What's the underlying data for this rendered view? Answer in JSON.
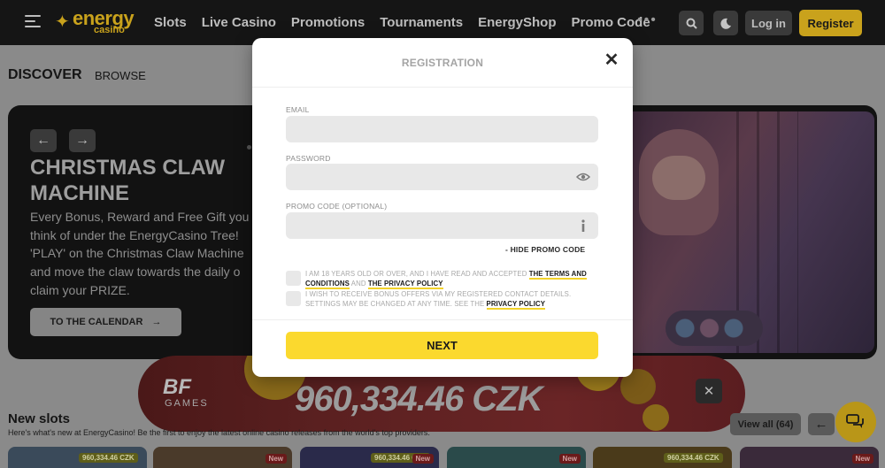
{
  "nav": {
    "logo_word": "energy",
    "logo_sub": "casino",
    "links": [
      "Slots",
      "Live Casino",
      "Promotions",
      "Tournaments",
      "EnergyShop",
      "Promo Code"
    ],
    "more": "•••",
    "login": "Log in",
    "register": "Register"
  },
  "page": {
    "discover": "DISCOVER",
    "browse": "BROWSE"
  },
  "hero": {
    "title": "CHRISTMAS CLAW MACHINE",
    "text_lines": [
      "Every Bonus, Reward and Free Gift you",
      "think of under the EnergyCasino Tree!",
      "'PLAY' on the Christmas Claw Machine",
      "and move the claw towards the daily o",
      "claim your PRIZE."
    ],
    "cta": "TO THE CALENDAR",
    "cta_arrow": "→",
    "prev": "←",
    "next": "→"
  },
  "jackpot": {
    "logo": "BF",
    "sub": "GAMES",
    "amount": "960,334.46 CZK",
    "close": "✕"
  },
  "new_slots": {
    "title": "New slots",
    "subtitle": "Here's what's new at EnergyCasino! Be the first to enjoy the latest online casino releases from the world's top providers.",
    "view_all": "View all (64)",
    "prev": "←",
    "tiles": [
      {
        "badge": "960,334.46 CZK",
        "new": ""
      },
      {
        "badge": "",
        "new": "New"
      },
      {
        "badge": "960,334.46 CZK",
        "new": "New"
      },
      {
        "badge": "",
        "new": "New"
      },
      {
        "badge": "960,334.46 CZK",
        "new": ""
      },
      {
        "badge": "",
        "new": "New"
      }
    ]
  },
  "modal": {
    "title": "REGISTRATION",
    "close": "✕",
    "email_label": "EMAIL",
    "email_value": "",
    "password_label": "PASSWORD",
    "password_value": "",
    "promo_label": "PROMO CODE (OPTIONAL)",
    "promo_value": "",
    "hide_promo": "-  HIDE PROMO CODE",
    "consent_age_pre": "I AM 18 YEARS OLD OR OVER, AND I HAVE READ AND ACCEPTED ",
    "consent_terms": "THE TERMS AND CONDITIONS",
    "consent_and": " AND ",
    "consent_privacy": "THE PRIVACY POLICY",
    "consent_bonus_pre": "I WISH TO RECEIVE BONUS OFFERS VIA MY REGISTERED CONTACT DETAILS. SETTINGS MAY BE CHANGED AT ANY TIME. SEE THE ",
    "consent_bonus_link": "PRIVACY POLICY",
    "next": "NEXT"
  },
  "colors": {
    "accent": "#fbd92e",
    "brand_gold": "#c9a21c",
    "nav_bg": "#151515"
  },
  "icons": {
    "search": "search-icon",
    "theme": "moon-icon",
    "eye": "eye-icon",
    "info": "info-icon",
    "chat": "chat-icon"
  }
}
